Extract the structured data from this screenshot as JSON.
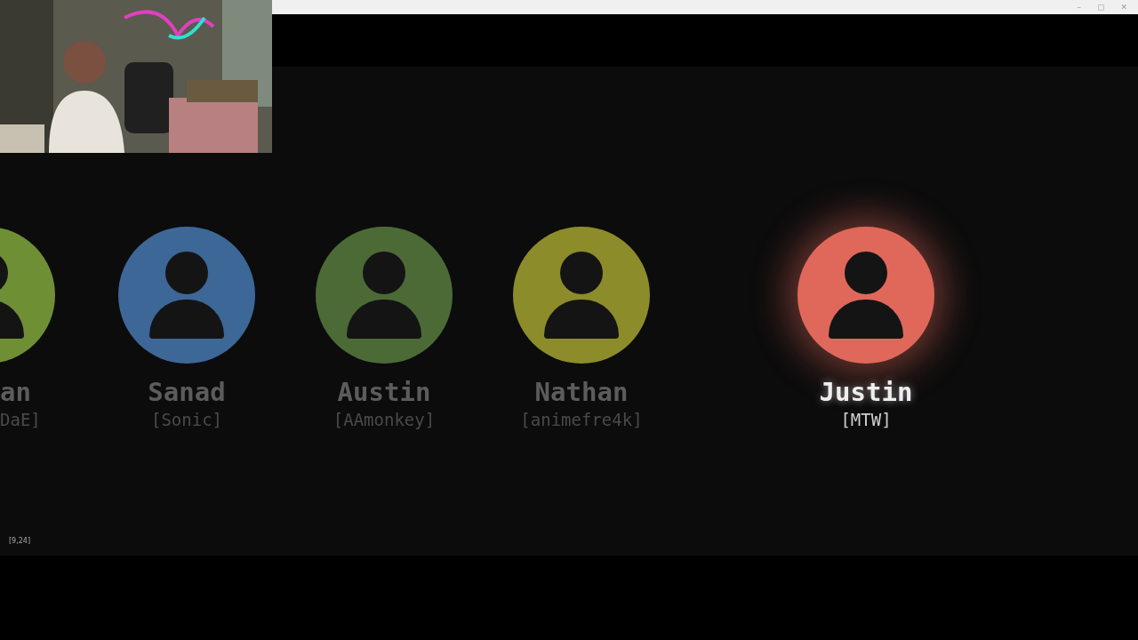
{
  "window": {
    "controls": [
      "–",
      "▢",
      "✕"
    ]
  },
  "players": [
    {
      "kind": "clipped",
      "name": "an",
      "tag": "DaE]",
      "color": "#6f8f35",
      "selected": false
    },
    {
      "name": "Sanad",
      "tag": "[Sonic]",
      "color": "#3d6797",
      "selected": false
    },
    {
      "name": "Austin",
      "tag": "[AAmonkey]",
      "color": "#4c6a36",
      "selected": false
    },
    {
      "name": "Nathan",
      "tag": "[animefre4k]",
      "color": "#8c8c2a",
      "selected": false
    },
    {
      "name": "Justin",
      "tag": "[MTW]",
      "color": "#e0685a",
      "selected": true
    }
  ],
  "coords": "[9,24]"
}
